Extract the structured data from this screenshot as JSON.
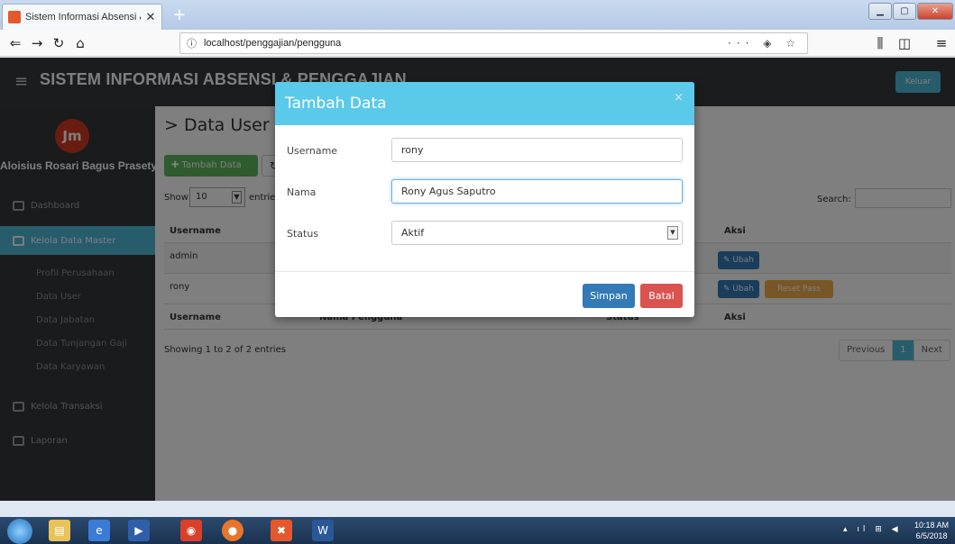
{
  "browser": {
    "tab_title": "Sistem Informasi Absensi & Pe",
    "url": "localhost/penggajian/pengguna",
    "url_actions": "··· ◈ ☆"
  },
  "app": {
    "title": "SISTEM INFORMASI ABSENSI & PENGGAJIAN",
    "logout_label": "Keluar"
  },
  "sidebar": {
    "user_name": "Aloisius Rosari Bagus Prasetya",
    "avatar_text": "Jm",
    "items": [
      {
        "label": "Dashboard",
        "icon": "dashboard-icon"
      },
      {
        "label": "Kelola Data Master",
        "icon": "list-icon"
      },
      {
        "label": "Kelola Transaksi",
        "icon": "book-icon"
      },
      {
        "label": "Laporan",
        "icon": "chart-icon"
      }
    ],
    "subitems": [
      "Profil Perusahaan",
      "Data User",
      "Data Jabatan",
      "Data Tunjangan Gaji",
      "Data Karyawan"
    ]
  },
  "content": {
    "page_title": "> Data User",
    "add_button": "✚ Tambah Data",
    "refresh_icon": "↻",
    "show_label": "Show",
    "entries_label": "entries",
    "page_length": "10",
    "search_label": "Search:",
    "table": {
      "headers": [
        "Username",
        "Aksi"
      ],
      "footer_headers": [
        "Username",
        "Nama Pengguna",
        "Status",
        "Aksi"
      ],
      "rows": [
        {
          "username": "admin",
          "edit_label": "✎ Ubah"
        },
        {
          "username": "rony",
          "edit_label": "✎ Ubah",
          "reset_label": "Reset Pass"
        }
      ]
    },
    "showing_text": "Showing 1 to 2 of 2 entries",
    "pager": {
      "previous": "Previous",
      "current": "1",
      "next": "Next"
    }
  },
  "modal": {
    "title": "Tambah Data",
    "close": "×",
    "fields": {
      "username_label": "Username",
      "username_value": "rony",
      "nama_label": "Nama",
      "nama_value": "Rony Agus Saputro",
      "status_label": "Status",
      "status_value": "Aktif"
    },
    "save_label": "Simpan",
    "cancel_label": "Batal"
  },
  "taskbar": {
    "time": "10:18 AM",
    "date": "6/5/2018"
  }
}
